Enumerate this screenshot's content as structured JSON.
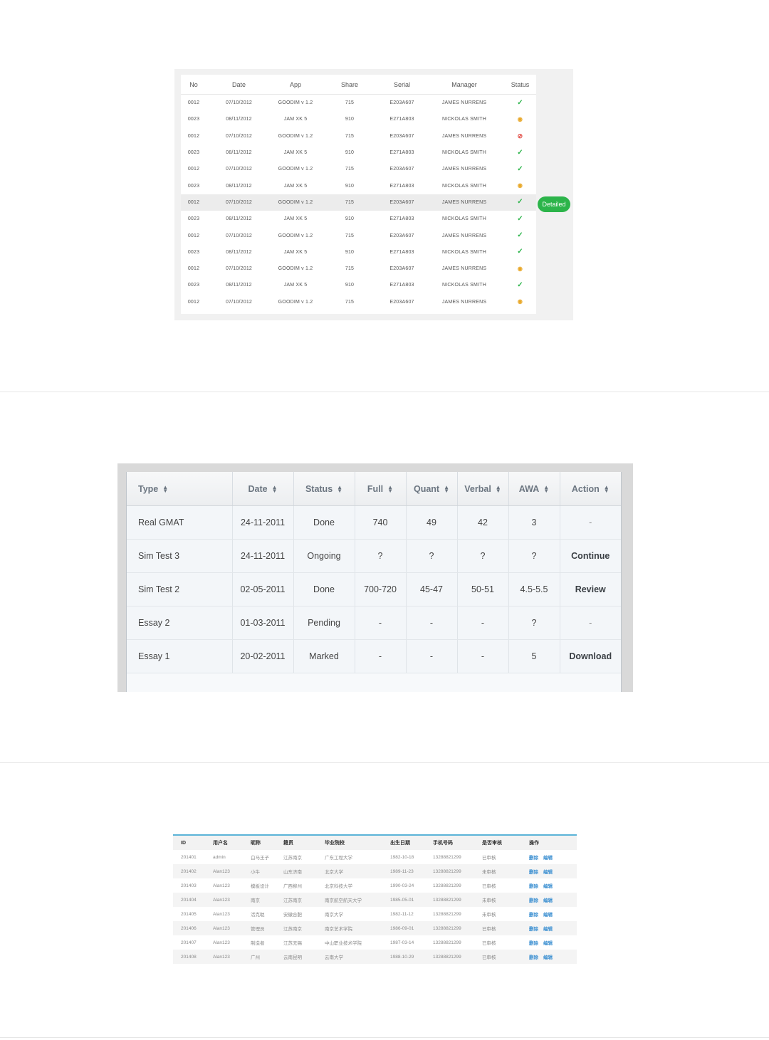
{
  "table1": {
    "headers": [
      "No",
      "Date",
      "App",
      "Share",
      "Serial",
      "Manager",
      "Status"
    ],
    "rows": [
      {
        "no": "0012",
        "date": "07/10/2012",
        "app": "GOODIM v 1.2",
        "share": "715",
        "serial": "E203A607",
        "manager": "JAMES NURRENS",
        "status": "ok"
      },
      {
        "no": "0023",
        "date": "08/11/2012",
        "app": "JAM XK 5",
        "share": "910",
        "serial": "E271A803",
        "manager": "NICKOLAS SMITH",
        "status": "pending"
      },
      {
        "no": "0012",
        "date": "07/10/2012",
        "app": "GOODIM v 1.2",
        "share": "715",
        "serial": "E203A607",
        "manager": "JAMES NURRENS",
        "status": "error"
      },
      {
        "no": "0023",
        "date": "08/11/2012",
        "app": "JAM XK 5",
        "share": "910",
        "serial": "E271A803",
        "manager": "NICKOLAS SMITH",
        "status": "ok"
      },
      {
        "no": "0012",
        "date": "07/10/2012",
        "app": "GOODIM v 1.2",
        "share": "715",
        "serial": "E203A607",
        "manager": "JAMES NURRENS",
        "status": "ok"
      },
      {
        "no": "0023",
        "date": "08/11/2012",
        "app": "JAM XK 5",
        "share": "910",
        "serial": "E271A803",
        "manager": "NICKOLAS SMITH",
        "status": "pending"
      },
      {
        "no": "0012",
        "date": "07/10/2012",
        "app": "GOODIM v 1.2",
        "share": "715",
        "serial": "E203A607",
        "manager": "JAMES NURRENS",
        "status": "ok",
        "highlighted": true
      },
      {
        "no": "0023",
        "date": "08/11/2012",
        "app": "JAM XK 5",
        "share": "910",
        "serial": "E271A803",
        "manager": "NICKOLAS SMITH",
        "status": "ok"
      },
      {
        "no": "0012",
        "date": "07/10/2012",
        "app": "GOODIM v 1.2",
        "share": "715",
        "serial": "E203A607",
        "manager": "JAMES NURRENS",
        "status": "ok"
      },
      {
        "no": "0023",
        "date": "08/11/2012",
        "app": "JAM XK 5",
        "share": "910",
        "serial": "E271A803",
        "manager": "NICKOLAS SMITH",
        "status": "ok"
      },
      {
        "no": "0012",
        "date": "07/10/2012",
        "app": "GOODIM v 1.2",
        "share": "715",
        "serial": "E203A607",
        "manager": "JAMES NURRENS",
        "status": "pending"
      },
      {
        "no": "0023",
        "date": "08/11/2012",
        "app": "JAM XK 5",
        "share": "910",
        "serial": "E271A803",
        "manager": "NICKOLAS SMITH",
        "status": "ok"
      },
      {
        "no": "0012",
        "date": "07/10/2012",
        "app": "GOODIM v 1.2",
        "share": "715",
        "serial": "E203A607",
        "manager": "JAMES NURRENS",
        "status": "pending"
      }
    ],
    "detailed_button": "Detailed",
    "status_glyphs": {
      "ok": "✓",
      "pending": "◉",
      "error": "⊘"
    },
    "status_icons": {
      "ok": "check-icon",
      "pending": "pending-icon",
      "error": "blocked-icon"
    },
    "colors": {
      "ok": "#2cb44a",
      "pending": "#e8a727",
      "error": "#e0433c"
    }
  },
  "table2": {
    "headers": [
      "Type",
      "Date",
      "Status",
      "Full",
      "Quant",
      "Verbal",
      "AWA",
      "Action"
    ],
    "rows": [
      {
        "type": "Real GMAT",
        "date": "24-11-2011",
        "status": "Done",
        "full": "740",
        "quant": "49",
        "verbal": "42",
        "awa": "3",
        "action": "-"
      },
      {
        "type": "Sim Test 3",
        "date": "24-11-2011",
        "status": "Ongoing",
        "full": "?",
        "quant": "?",
        "verbal": "?",
        "awa": "?",
        "action": "Continue"
      },
      {
        "type": "Sim Test 2",
        "date": "02-05-2011",
        "status": "Done",
        "full": "700-720",
        "quant": "45-47",
        "verbal": "50-51",
        "awa": "4.5-5.5",
        "action": "Review"
      },
      {
        "type": "Essay 2",
        "date": "01-03-2011",
        "status": "Pending",
        "full": "-",
        "quant": "-",
        "verbal": "-",
        "awa": "?",
        "action": "-"
      },
      {
        "type": "Essay 1",
        "date": "20-02-2011",
        "status": "Marked",
        "full": "-",
        "quant": "-",
        "verbal": "-",
        "awa": "5",
        "action": "Download"
      }
    ]
  },
  "table3": {
    "headers": [
      "ID",
      "用户名",
      "昵称",
      "籍贯",
      "毕业院校",
      "出生日期",
      "手机号码",
      "是否审核",
      "操作"
    ],
    "rows": [
      {
        "id": "201401",
        "username": "admin",
        "nickname": "白马王子",
        "origin": "江苏南京",
        "school": "广东工程大学",
        "birth": "1982-10-18",
        "phone": "13288821299",
        "reviewed": "已审核"
      },
      {
        "id": "201402",
        "username": "Alan123",
        "nickname": "小牛",
        "origin": "山东济南",
        "school": "北京大学",
        "birth": "1989-11-23",
        "phone": "13288821299",
        "reviewed": "未审核"
      },
      {
        "id": "201403",
        "username": "Alan123",
        "nickname": "模板设计",
        "origin": "广西柳州",
        "school": "北京科技大学",
        "birth": "1990-03-24",
        "phone": "13288821299",
        "reviewed": "已审核"
      },
      {
        "id": "201404",
        "username": "Alan123",
        "nickname": "南京",
        "origin": "江苏南京",
        "school": "南京航空航天大学",
        "birth": "1985-05-01",
        "phone": "13288821299",
        "reviewed": "未审核"
      },
      {
        "id": "201405",
        "username": "Alan123",
        "nickname": "活克耽",
        "origin": "安徽合肥",
        "school": "南京大学",
        "birth": "1982-11-12",
        "phone": "13288821299",
        "reviewed": "未审核"
      },
      {
        "id": "201406",
        "username": "Alan123",
        "nickname": "管理员",
        "origin": "江苏南京",
        "school": "南京艺术学院",
        "birth": "1986-09-01",
        "phone": "13288821299",
        "reviewed": "已审核"
      },
      {
        "id": "201407",
        "username": "Alan123",
        "nickname": "制造者",
        "origin": "江苏无锡",
        "school": "中山职业技术学院",
        "birth": "1987-03-14",
        "phone": "13288821299",
        "reviewed": "已审核"
      },
      {
        "id": "201408",
        "username": "Alan123",
        "nickname": "广州",
        "origin": "云南昆明",
        "school": "云南大学",
        "birth": "1988-10-29",
        "phone": "13288821299",
        "reviewed": "已审核"
      }
    ],
    "actions": {
      "delete": "删除",
      "edit": "编辑"
    },
    "colors": {
      "header_rule": "#5bb3d8",
      "link": "#3b8fd1"
    }
  }
}
